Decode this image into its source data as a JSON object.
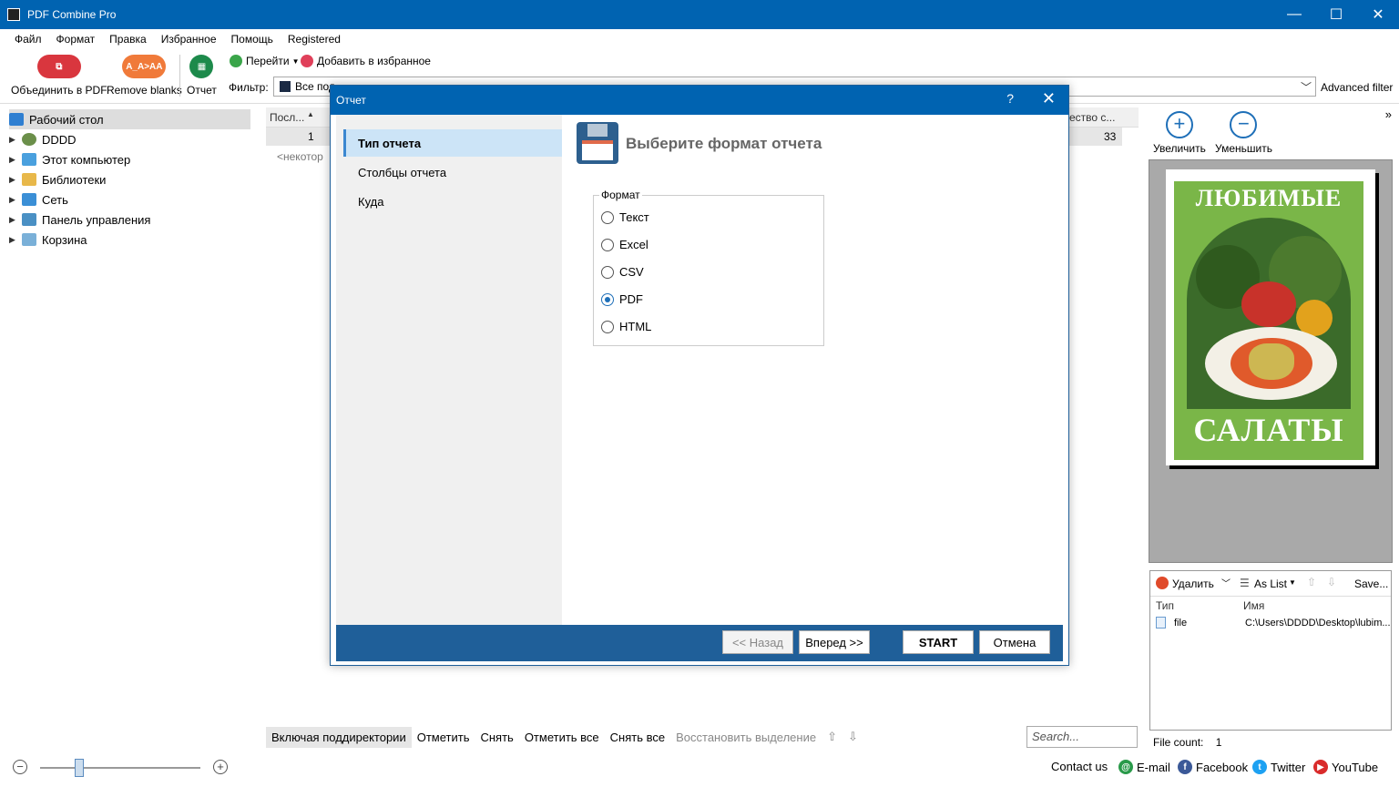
{
  "app": {
    "title": "PDF Combine Pro"
  },
  "window_controls": {
    "minimize": "—",
    "maximize": "☐",
    "close": "✕"
  },
  "menu": [
    "Файл",
    "Формат",
    "Правка",
    "Избранное",
    "Помощь",
    "Registered"
  ],
  "toolbar": {
    "combine_label": "Объединить в PDF",
    "combine_icon_text": "⧉",
    "remove_blanks_label": "Remove blanks",
    "remove_blanks_icon_text": "A_A>AA",
    "report_label": "Отчет",
    "goto_label": "Перейти",
    "favorite_label": "Добавить в избранное",
    "filter_label": "Фильтр:",
    "filter_value": "Все под",
    "advanced_filter": "Advanced filter"
  },
  "tree": {
    "items": [
      {
        "label": "Рабочий стол",
        "color": "#2f7fd1"
      },
      {
        "label": "DDDD",
        "color": "#6b8f4a"
      },
      {
        "label": "Этот компьютер",
        "color": "#4aa0de"
      },
      {
        "label": "Библиотеки",
        "color": "#e8b84a"
      },
      {
        "label": "Сеть",
        "color": "#3b8fd6"
      },
      {
        "label": "Панель управления",
        "color": "#4a90c4"
      },
      {
        "label": "Корзина",
        "color": "#7ab0d8"
      }
    ]
  },
  "grid": {
    "col_first": "Посл...",
    "col_last": "ество с...",
    "row_index": "1",
    "row_count": "33",
    "empty_text": "<некотор"
  },
  "preview": {
    "zoom_in": "Увеличить",
    "zoom_out": "Уменьшить",
    "expand_icon": "»",
    "book_title_top": "ЛЮБИМЫЕ",
    "book_title_bottom": "САЛАТЫ"
  },
  "files_panel": {
    "delete_label": "Удалить",
    "as_list_label": "As List",
    "save_label": "Save...",
    "col_type": "Тип",
    "col_name": "Имя",
    "row_type": "file",
    "row_name": "C:\\Users\\DDDD\\Desktop\\lubim...",
    "file_count_label": "File count:",
    "file_count_value": "1"
  },
  "bottom": {
    "include_subdirs": "Включая поддиректории",
    "mark": "Отметить",
    "unmark": "Снять",
    "mark_all": "Отметить все",
    "unmark_all": "Снять все",
    "restore_sel": "Восстановить выделение",
    "search_placeholder": "Search..."
  },
  "status": {
    "contact": "Contact us",
    "email": "E-mail",
    "facebook": "Facebook",
    "twitter": "Twitter",
    "youtube": "YouTube"
  },
  "dialog": {
    "title": "Отчет",
    "help": "?",
    "close": "✕",
    "steps": [
      "Тип отчета",
      "Столбцы отчета",
      "Куда"
    ],
    "heading": "Выберите формат отчета",
    "group_label": "Формат",
    "options": [
      "Текст",
      "Excel",
      "CSV",
      "PDF",
      "HTML"
    ],
    "selected_option": "PDF",
    "back_button": "<< Назад",
    "next_button": "Вперед >>",
    "start_button": "START",
    "cancel_button": "Отмена"
  },
  "colors": {
    "titlebar": "#0063b1",
    "dialog_footer": "#1f5f99",
    "accent": "#1e6fb8"
  }
}
